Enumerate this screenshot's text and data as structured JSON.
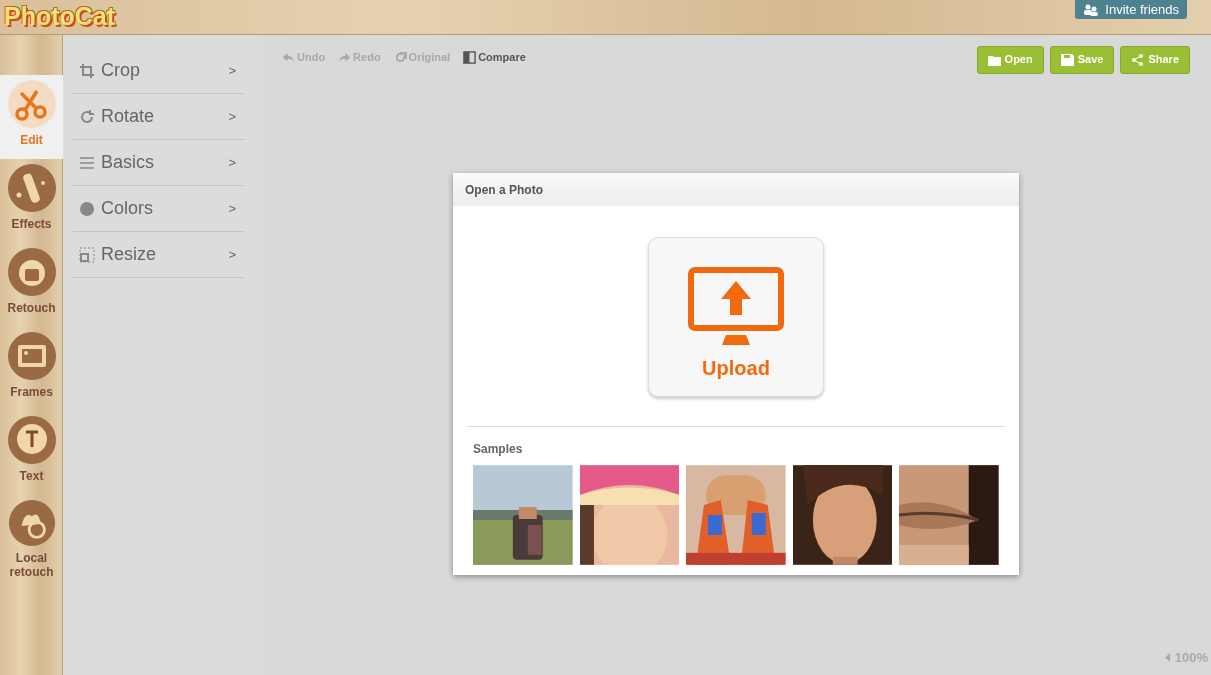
{
  "logo": "PhotoCat",
  "invite_button": "Invite friends",
  "rail": [
    {
      "label": "Edit",
      "selected": true
    },
    {
      "label": "Effects",
      "selected": false
    },
    {
      "label": "Retouch",
      "selected": false
    },
    {
      "label": "Frames",
      "selected": false
    },
    {
      "label": "Text",
      "selected": false
    },
    {
      "label": "Local retouch",
      "selected": false
    }
  ],
  "submenu": [
    {
      "label": "Crop",
      "arrow": ">"
    },
    {
      "label": "Rotate",
      "arrow": ">"
    },
    {
      "label": "Basics",
      "arrow": ">"
    },
    {
      "label": "Colors",
      "arrow": ">"
    },
    {
      "label": "Resize",
      "arrow": ">"
    }
  ],
  "toolbar": [
    {
      "label": "Undo",
      "disabled": true
    },
    {
      "label": "Redo",
      "disabled": true
    },
    {
      "label": "Original",
      "disabled": true
    },
    {
      "label": "Compare",
      "disabled": false
    }
  ],
  "actions": [
    "Open",
    "Save",
    "Share"
  ],
  "dialog": {
    "title": "Open a Photo",
    "upload": "Upload",
    "samples_label": "Samples"
  },
  "zoom": "100%"
}
